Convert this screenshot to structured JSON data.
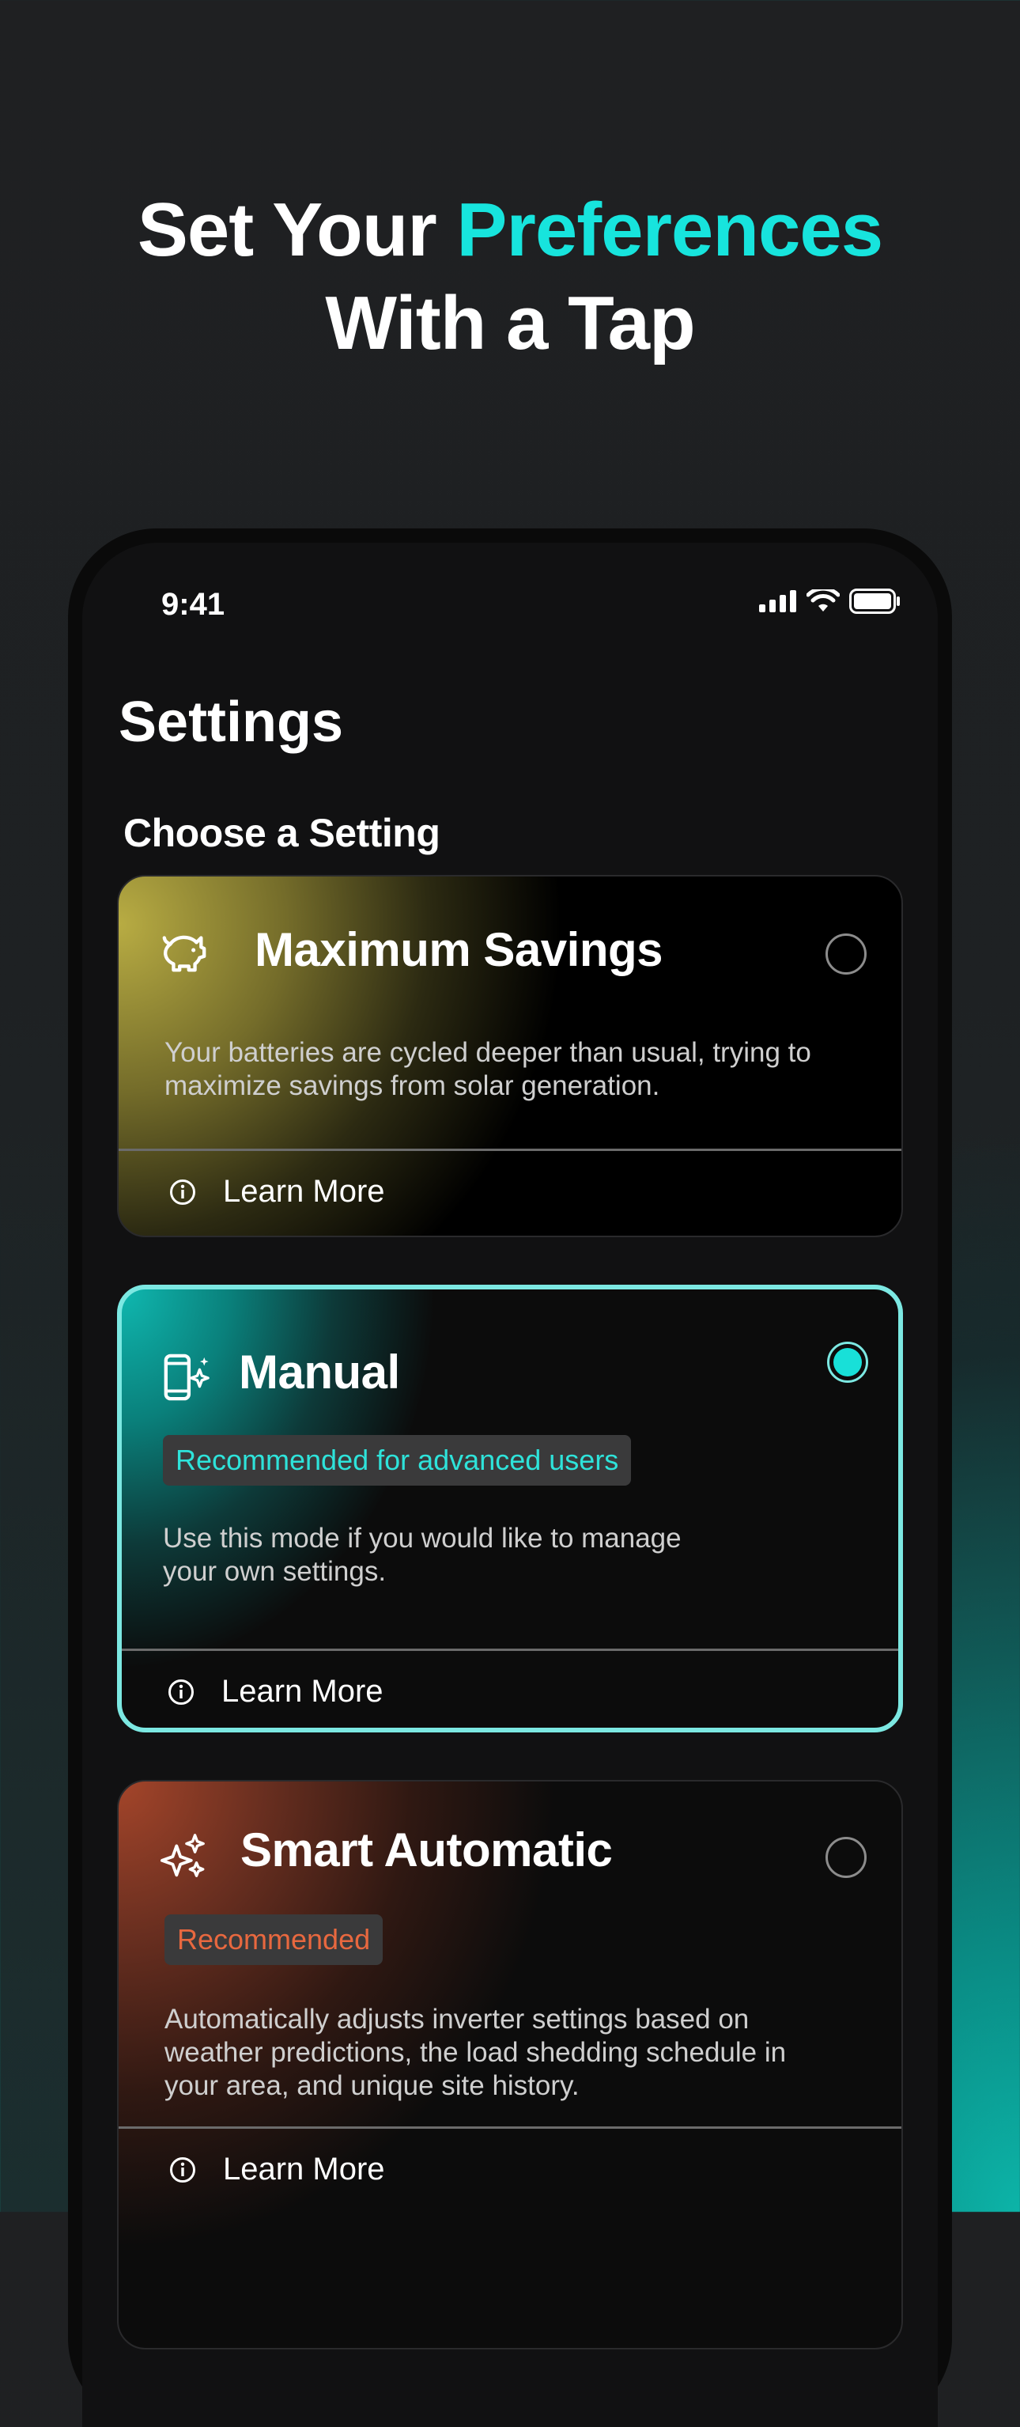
{
  "headline": {
    "line1_prefix": "Set Your ",
    "line1_accent": "Preferences",
    "line2": "With a Tap"
  },
  "status_bar": {
    "time": "9:41"
  },
  "screen": {
    "title": "Settings",
    "section_label": "Choose a Setting"
  },
  "cards": [
    {
      "title": "Maximum Savings",
      "icon": "piggy-bank-icon",
      "description_lines": [
        "Your batteries are cycled deeper than usual, trying to",
        "maximize savings from solar generation."
      ],
      "learn_more": "Learn More",
      "selected": false,
      "accent_color": "#b8ac43"
    },
    {
      "title": "Manual",
      "icon": "phone-sparkle-icon",
      "badge": "Recommended for advanced users",
      "description_lines": [
        "Use this mode if you would like to manage",
        "your own settings."
      ],
      "learn_more": "Learn More",
      "selected": true,
      "accent_color": "#18e0d8"
    },
    {
      "title": "Smart Automatic",
      "icon": "sparkles-icon",
      "badge": "Recommended",
      "description_lines": [
        "Automatically adjusts inverter settings based on",
        "weather predictions, the load shedding schedule in",
        "your area, and unique site history."
      ],
      "learn_more": "Learn More",
      "selected": false,
      "accent_color": "#e0623a"
    }
  ],
  "colors": {
    "accent_cyan": "#17e4dd",
    "selected_border": "#7ce8e2",
    "badge_text_manual": "#2ee3da",
    "badge_text_smart": "#e8683f"
  }
}
